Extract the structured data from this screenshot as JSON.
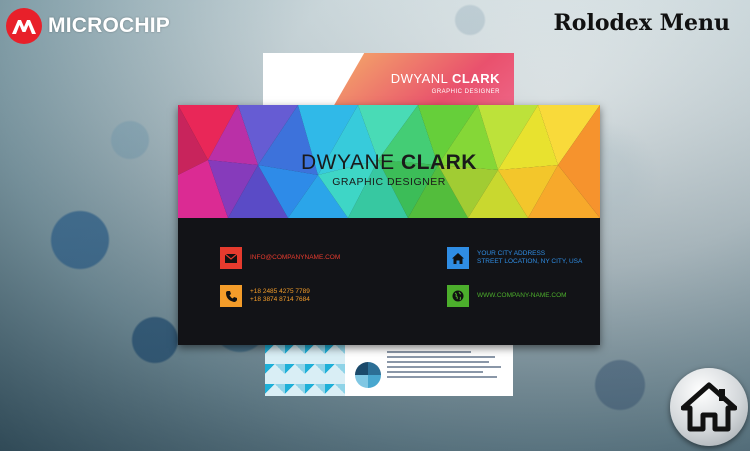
{
  "header": {
    "logo_text": "MICROCHIP",
    "title": "Rolodex Menu"
  },
  "cards": {
    "back": {
      "name_first": "DWYANL",
      "name_last": "CLARK",
      "subtitle": "GRAPHIC DESIGNER"
    },
    "main": {
      "name_first": "DWYANE",
      "name_last": "CLARK",
      "subtitle": "GRAPHIC DESIGNER",
      "email": "INFO@COMPANYNAME.COM",
      "phone_1": "+18 2485 4275 7789",
      "phone_2": "+18 3874 8714 7684",
      "address_1": "YOUR CITY ADDRESS",
      "address_2": "STREET LOCATION, NY CITY, USA",
      "website": "WWW.COMPANY-NAME.COM",
      "email_color": "#e63b2e",
      "phone_color": "#f39c2a",
      "address_color": "#2f8de4",
      "web_color": "#4cae2c"
    }
  },
  "icons": {
    "logo": "microchip-logo-icon",
    "email": "envelope-icon",
    "phone": "phone-icon",
    "address": "home-icon",
    "web": "globe-icon",
    "home_button": "home-icon"
  }
}
